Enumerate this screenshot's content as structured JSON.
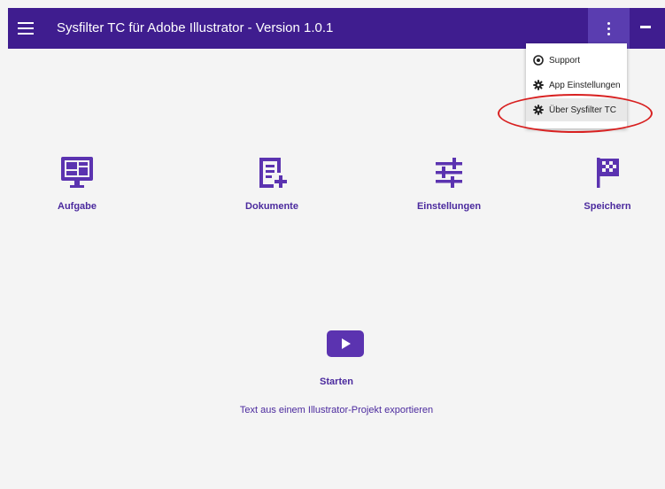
{
  "app": {
    "title": "Sysfilter TC für Adobe Illustrator - Version 1.0.1"
  },
  "dropdown": {
    "items": [
      {
        "label": "Support",
        "icon": "support-icon"
      },
      {
        "label": "App Einstellungen",
        "icon": "gear-icon"
      },
      {
        "label": "Über Sysfilter TC",
        "icon": "gear-icon"
      }
    ]
  },
  "tiles": [
    {
      "label": "Aufgabe",
      "icon": "monitor-dashboard-icon"
    },
    {
      "label": "Dokumente",
      "icon": "document-plus-icon"
    },
    {
      "label": "Einstellungen",
      "icon": "tune-sliders-icon"
    },
    {
      "label": "Speichern",
      "icon": "checkered-flag-icon"
    }
  ],
  "start": {
    "label": "Starten",
    "description": "Text aus einem Illustrator-Projekt exportieren"
  },
  "colors": {
    "titlebar": "#3f1d8f",
    "accent": "#5b33b0",
    "highlight_circle": "#d82020"
  }
}
